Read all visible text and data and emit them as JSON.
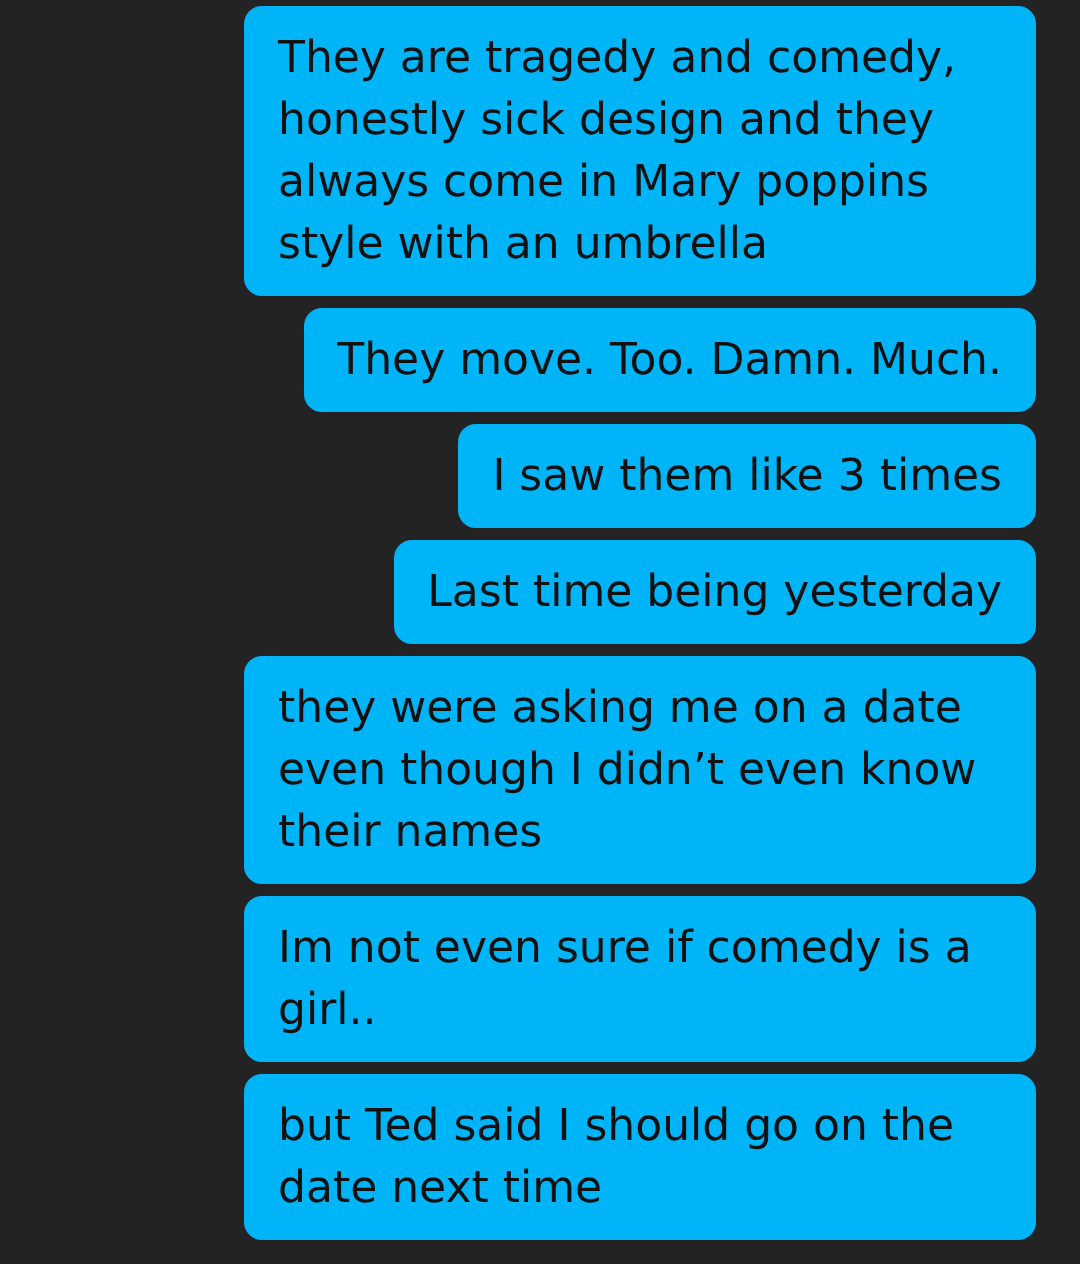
{
  "messages": [
    {
      "text": "They are tragedy and comedy, honestly sick design and they always come in Mary poppins style with an umbrella"
    },
    {
      "text": "They move. Too. Damn. Much."
    },
    {
      "text": "I saw them like 3 times"
    },
    {
      "text": "Last time being yesterday"
    },
    {
      "text": "they were asking me on a date even though I didn’t even know their names"
    },
    {
      "text": "Im not even sure if comedy is a girl.."
    },
    {
      "text": "but Ted said I should go on the date next time"
    }
  ]
}
